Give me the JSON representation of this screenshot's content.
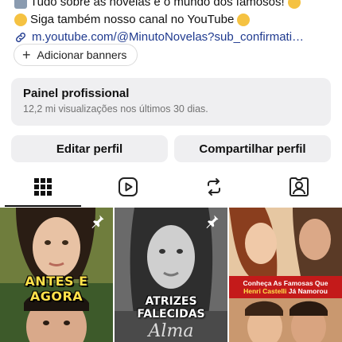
{
  "bio": {
    "line1": "Tudo sobre as novelas e o mundo dos famosos!",
    "line2": "Siga também nosso canal no YouTube",
    "link": "m.youtube.com/@MinutoNovelas?sub_confirmati…"
  },
  "add_banners": {
    "label": "Adicionar banners",
    "icon": "plus-icon"
  },
  "panel": {
    "title": "Painel profissional",
    "subtitle": "12,2 mi visualizações nos últimos 30 dias."
  },
  "buttons": {
    "edit": "Editar perfil",
    "share": "Compartilhar perfil"
  },
  "tabs": [
    {
      "icon": "grid-icon",
      "active": true
    },
    {
      "icon": "reels-icon",
      "active": false
    },
    {
      "icon": "repost-icon",
      "active": false
    },
    {
      "icon": "tagged-icon",
      "active": false
    }
  ],
  "posts": [
    {
      "caption": "ANTES E AGORA",
      "pinned": true
    },
    {
      "caption": "ATRIZES FALECIDAS",
      "script_text": "Alma",
      "pinned": true
    },
    {
      "caption_line1": "Conheça As Famosas Que",
      "caption_highlight": "Henri Castelli",
      "caption_line2": "Já Namorou",
      "pinned": false
    }
  ],
  "colors": {
    "link": "#1f3a8f",
    "panel_bg": "#efeff1",
    "banner_red": "#c41a1a",
    "caption_yellow": "#ffe14a"
  }
}
